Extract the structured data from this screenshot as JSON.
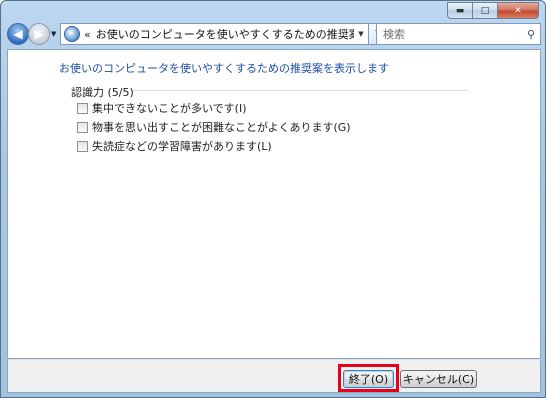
{
  "window": {
    "caption_buttons": {
      "minimize": "▬",
      "maximize": "□",
      "close": "✕"
    }
  },
  "nav": {
    "back_icon": "◀",
    "forward_icon": "▶",
    "dropdown_icon": "▼",
    "address": {
      "chevron": "«",
      "path": "お使いのコンピュータを使いやすくするための推奨案を...",
      "dropdown_icon": "▼"
    },
    "refresh_icon": "↻",
    "search": {
      "placeholder": "検索",
      "icon": "⚲"
    }
  },
  "main": {
    "heading": "お使いのコンピュータを使いやすくするための推奨案を表示します",
    "group_label": "認識力 (5/5)",
    "options": [
      {
        "label": "集中できないことが多いです(I)",
        "checked": false
      },
      {
        "label": "物事を思い出すことが困難なことがよくあります(G)",
        "checked": false
      },
      {
        "label": "失読症などの学習障害があります(L)",
        "checked": false
      }
    ]
  },
  "footer": {
    "finish_label": "終了(O)",
    "cancel_label": "キャンセル(C)"
  },
  "colors": {
    "heading": "#1f4ea1",
    "highlight": "#e8001b",
    "frame": "#a9c7e5"
  }
}
